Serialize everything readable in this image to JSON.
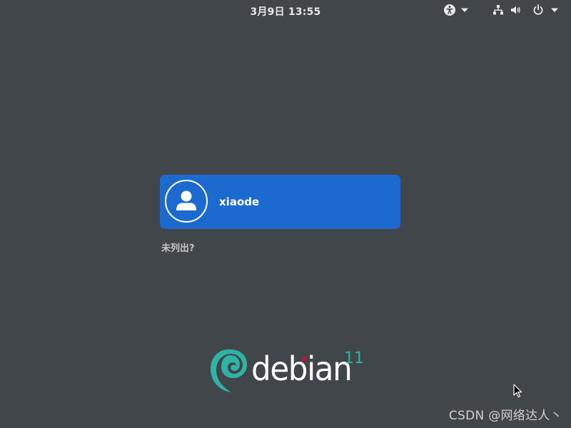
{
  "topbar": {
    "clock": "3月9日  13:55",
    "accessibility_icon": "accessibility-icon",
    "network_icon": "network-wired-icon",
    "volume_icon": "volume-icon",
    "power_icon": "power-icon"
  },
  "users": [
    {
      "name": "xiaode",
      "avatar_icon": "user-avatar-icon"
    }
  ],
  "not_listed": "未列出?",
  "branding": {
    "word": "debian",
    "version": "11",
    "accent": "#2fb3a5",
    "dot_color": "#c1123c"
  },
  "watermark": "CSDN @网络达人丶",
  "colors": {
    "background": "#41464a",
    "selected_user": "#1c69cf"
  }
}
